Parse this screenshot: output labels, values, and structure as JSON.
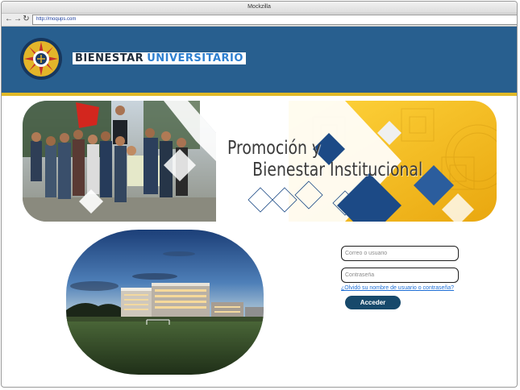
{
  "browser": {
    "window_title": "Mockzilla",
    "url": "http://moqups.com",
    "back_glyph": "←",
    "forward_glyph": "→",
    "reload_glyph": "↻"
  },
  "header": {
    "brand_part1": "BIENESTAR",
    "brand_part2": "UNIVERSITARIO",
    "background_color": "#285f8f",
    "accent_color": "#e1b927",
    "seal_icon": "university-seal-icon"
  },
  "banner": {
    "title_line1": "Promoción y",
    "title_line2": "Bienestar Institucional",
    "image_description_icon": "students-group-photo"
  },
  "campus_image": {
    "icon": "campus-building-photo"
  },
  "login": {
    "user_placeholder": "Correo o usuario",
    "password_placeholder": "Contraseña",
    "forgot_link": "¿Olvidó su nombre de usuario o contraseña?",
    "submit_label": "Acceder",
    "button_color": "#17496b"
  }
}
